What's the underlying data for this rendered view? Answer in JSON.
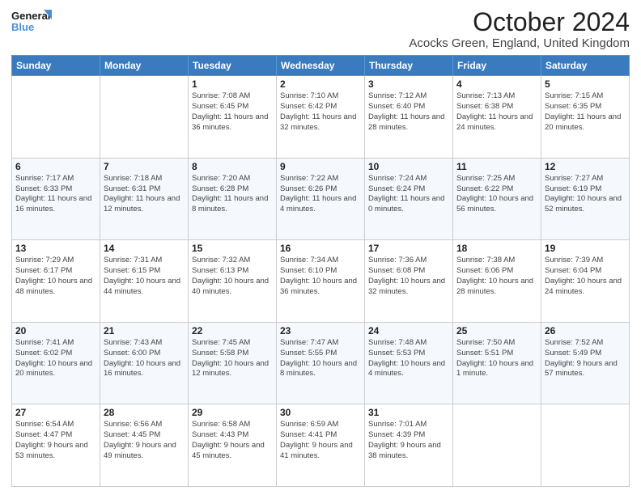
{
  "header": {
    "logo_line1": "General",
    "logo_line2": "Blue",
    "title": "October 2024",
    "subtitle": "Acocks Green, England, United Kingdom"
  },
  "weekdays": [
    "Sunday",
    "Monday",
    "Tuesday",
    "Wednesday",
    "Thursday",
    "Friday",
    "Saturday"
  ],
  "weeks": [
    [
      {
        "day": "",
        "info": ""
      },
      {
        "day": "",
        "info": ""
      },
      {
        "day": "1",
        "info": "Sunrise: 7:08 AM\nSunset: 6:45 PM\nDaylight: 11 hours and 36 minutes."
      },
      {
        "day": "2",
        "info": "Sunrise: 7:10 AM\nSunset: 6:42 PM\nDaylight: 11 hours and 32 minutes."
      },
      {
        "day": "3",
        "info": "Sunrise: 7:12 AM\nSunset: 6:40 PM\nDaylight: 11 hours and 28 minutes."
      },
      {
        "day": "4",
        "info": "Sunrise: 7:13 AM\nSunset: 6:38 PM\nDaylight: 11 hours and 24 minutes."
      },
      {
        "day": "5",
        "info": "Sunrise: 7:15 AM\nSunset: 6:35 PM\nDaylight: 11 hours and 20 minutes."
      }
    ],
    [
      {
        "day": "6",
        "info": "Sunrise: 7:17 AM\nSunset: 6:33 PM\nDaylight: 11 hours and 16 minutes."
      },
      {
        "day": "7",
        "info": "Sunrise: 7:18 AM\nSunset: 6:31 PM\nDaylight: 11 hours and 12 minutes."
      },
      {
        "day": "8",
        "info": "Sunrise: 7:20 AM\nSunset: 6:28 PM\nDaylight: 11 hours and 8 minutes."
      },
      {
        "day": "9",
        "info": "Sunrise: 7:22 AM\nSunset: 6:26 PM\nDaylight: 11 hours and 4 minutes."
      },
      {
        "day": "10",
        "info": "Sunrise: 7:24 AM\nSunset: 6:24 PM\nDaylight: 11 hours and 0 minutes."
      },
      {
        "day": "11",
        "info": "Sunrise: 7:25 AM\nSunset: 6:22 PM\nDaylight: 10 hours and 56 minutes."
      },
      {
        "day": "12",
        "info": "Sunrise: 7:27 AM\nSunset: 6:19 PM\nDaylight: 10 hours and 52 minutes."
      }
    ],
    [
      {
        "day": "13",
        "info": "Sunrise: 7:29 AM\nSunset: 6:17 PM\nDaylight: 10 hours and 48 minutes."
      },
      {
        "day": "14",
        "info": "Sunrise: 7:31 AM\nSunset: 6:15 PM\nDaylight: 10 hours and 44 minutes."
      },
      {
        "day": "15",
        "info": "Sunrise: 7:32 AM\nSunset: 6:13 PM\nDaylight: 10 hours and 40 minutes."
      },
      {
        "day": "16",
        "info": "Sunrise: 7:34 AM\nSunset: 6:10 PM\nDaylight: 10 hours and 36 minutes."
      },
      {
        "day": "17",
        "info": "Sunrise: 7:36 AM\nSunset: 6:08 PM\nDaylight: 10 hours and 32 minutes."
      },
      {
        "day": "18",
        "info": "Sunrise: 7:38 AM\nSunset: 6:06 PM\nDaylight: 10 hours and 28 minutes."
      },
      {
        "day": "19",
        "info": "Sunrise: 7:39 AM\nSunset: 6:04 PM\nDaylight: 10 hours and 24 minutes."
      }
    ],
    [
      {
        "day": "20",
        "info": "Sunrise: 7:41 AM\nSunset: 6:02 PM\nDaylight: 10 hours and 20 minutes."
      },
      {
        "day": "21",
        "info": "Sunrise: 7:43 AM\nSunset: 6:00 PM\nDaylight: 10 hours and 16 minutes."
      },
      {
        "day": "22",
        "info": "Sunrise: 7:45 AM\nSunset: 5:58 PM\nDaylight: 10 hours and 12 minutes."
      },
      {
        "day": "23",
        "info": "Sunrise: 7:47 AM\nSunset: 5:55 PM\nDaylight: 10 hours and 8 minutes."
      },
      {
        "day": "24",
        "info": "Sunrise: 7:48 AM\nSunset: 5:53 PM\nDaylight: 10 hours and 4 minutes."
      },
      {
        "day": "25",
        "info": "Sunrise: 7:50 AM\nSunset: 5:51 PM\nDaylight: 10 hours and 1 minute."
      },
      {
        "day": "26",
        "info": "Sunrise: 7:52 AM\nSunset: 5:49 PM\nDaylight: 9 hours and 57 minutes."
      }
    ],
    [
      {
        "day": "27",
        "info": "Sunrise: 6:54 AM\nSunset: 4:47 PM\nDaylight: 9 hours and 53 minutes."
      },
      {
        "day": "28",
        "info": "Sunrise: 6:56 AM\nSunset: 4:45 PM\nDaylight: 9 hours and 49 minutes."
      },
      {
        "day": "29",
        "info": "Sunrise: 6:58 AM\nSunset: 4:43 PM\nDaylight: 9 hours and 45 minutes."
      },
      {
        "day": "30",
        "info": "Sunrise: 6:59 AM\nSunset: 4:41 PM\nDaylight: 9 hours and 41 minutes."
      },
      {
        "day": "31",
        "info": "Sunrise: 7:01 AM\nSunset: 4:39 PM\nDaylight: 9 hours and 38 minutes."
      },
      {
        "day": "",
        "info": ""
      },
      {
        "day": "",
        "info": ""
      }
    ]
  ]
}
